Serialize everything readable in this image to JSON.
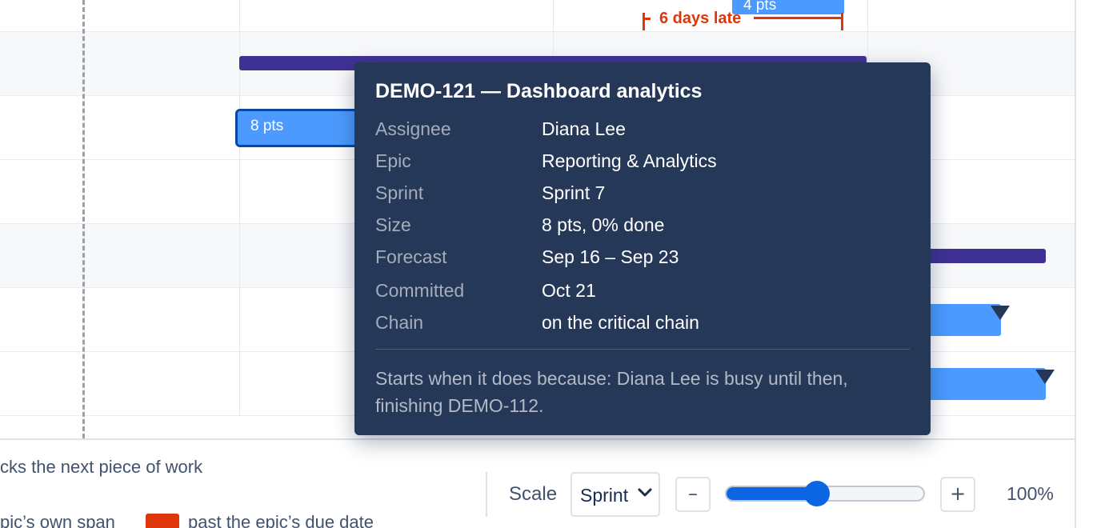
{
  "bars": {
    "top_story_label": "4 pts",
    "selected_story_label": "8 pts"
  },
  "late_marker": {
    "label": "6 days late",
    "color": "#de350b"
  },
  "colors": {
    "epic": "#403294",
    "story": "#4c9aff",
    "late": "#de350b",
    "tooltip_bg": "#253858",
    "accent": "#0c66e4"
  },
  "legend": {
    "line1": "cks the next piece of work",
    "line2": "pic’s own span",
    "line3": "past the epic’s due date"
  },
  "controls": {
    "scale_label": "Scale",
    "scale_value": "Sprint",
    "minus": "–",
    "plus": "+",
    "zoom_fraction": 0.46,
    "zoom_label": "100%"
  },
  "tooltip": {
    "title": "DEMO-121 — Dashboard analytics",
    "rows": [
      {
        "key": "Assignee",
        "value": "Diana Lee"
      },
      {
        "key": "Epic",
        "value": "Reporting & Analytics"
      },
      {
        "key": "Sprint",
        "value": "Sprint 7"
      },
      {
        "key": "Size",
        "value": "8 pts, 0% done"
      },
      {
        "key": "Forecast",
        "value": "Sep 16 – Sep 23"
      },
      {
        "key": "Committed",
        "value": "Oct 21"
      },
      {
        "key": "Chain",
        "value": "on the critical chain"
      }
    ],
    "note": "Starts when it does because: Diana Lee is busy until then, finishing DEMO-112."
  }
}
